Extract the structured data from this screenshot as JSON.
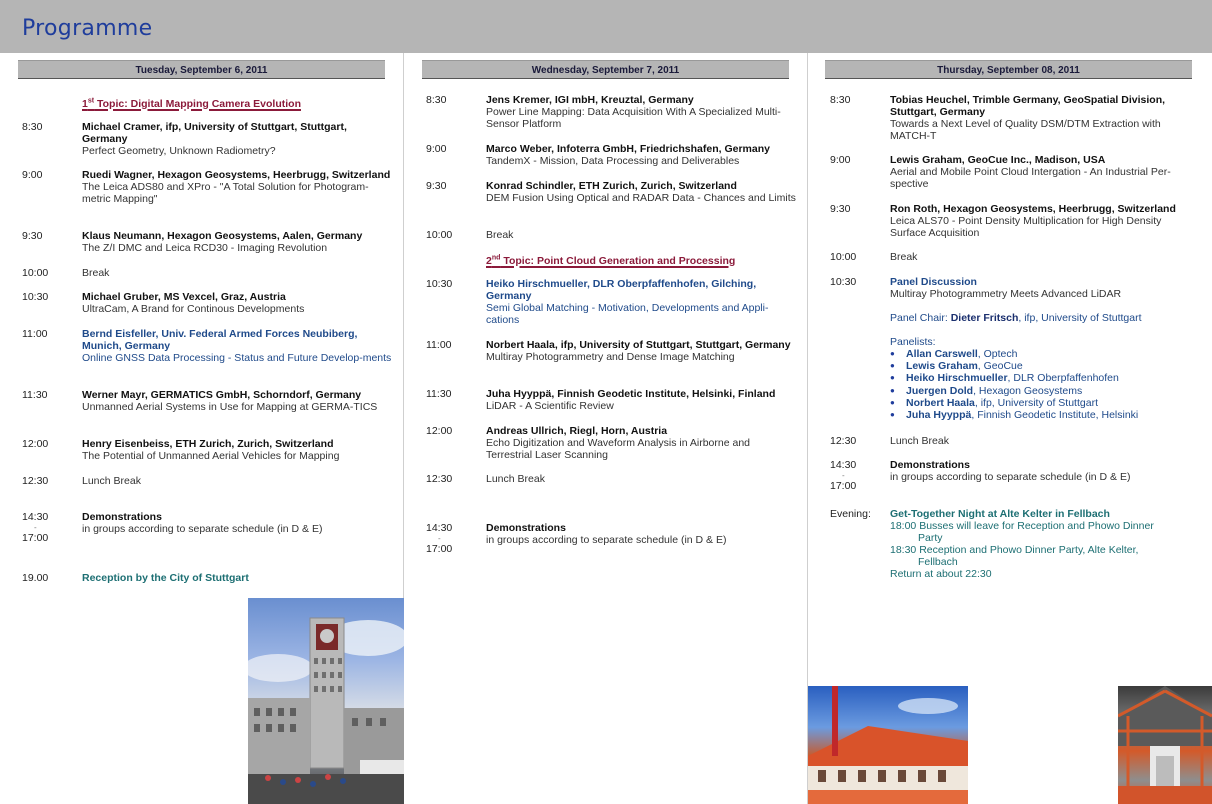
{
  "page": {
    "title": "Programme"
  },
  "day1": {
    "header": "Tuesday, September 6, 2011",
    "topic1_num": "1",
    "topic1_sup": "st",
    "topic1_text": " Topic: Digital Mapping Camera Evolution",
    "items": [
      {
        "time": "8:30",
        "speaker": "Michael Cramer, ifp, University of Stuttgart, Stuttgart, Germany",
        "title": "Perfect Geometry, Unknown Radiometry?"
      },
      {
        "time": "9:00",
        "speaker": "Ruedi Wagner, Hexagon Geosystems, Heerbrugg, Switzerland",
        "title": "The Leica ADS80 and XPro - \"A Total Solution for Photogram-metric Mapping\""
      },
      {
        "time": "9:30",
        "speaker": "Klaus Neumann, Hexagon Geosystems, Aalen, Germany",
        "title": "The Z/I DMC and Leica RCD30 - Imaging Revolution"
      },
      {
        "time": "10:00",
        "title": "Break"
      },
      {
        "time": "10:30",
        "speaker": "Michael Gruber, MS Vexcel, Graz, Austria",
        "title": "UltraCam, A Brand for Continous Developments"
      },
      {
        "time": "11:00",
        "speaker": "Bernd Eisfeller, Univ. Federal Armed Forces Neubiberg, Munich, Germany",
        "title": "Online GNSS Data Processing - Status and Future Develop-ments"
      },
      {
        "time": "11:30",
        "speaker": "Werner Mayr, GERMATICS GmbH, Schorndorf, Germany",
        "title": "Unmanned Aerial Systems in Use for Mapping at GERMA-TICS"
      },
      {
        "time": "12:00",
        "speaker": "Henry Eisenbeiss, ETH Zurich, Zurich, Switzerland",
        "title": "The Potential of Unmanned Aerial Vehicles for Mapping"
      },
      {
        "time": "12:30",
        "title": "Lunch Break"
      },
      {
        "time": "14:30",
        "time_end": "17:00",
        "dash": "-",
        "speaker": "Demonstrations",
        "title": "in groups according to separate schedule (in D & E)"
      },
      {
        "time": "19.00",
        "speaker": "Reception by the City of Stuttgart"
      }
    ]
  },
  "day2": {
    "header": "Wednesday, September 7, 2011",
    "topic2_num": "2",
    "topic2_sup": "nd",
    "topic2_text": " Topic: Point Cloud Generation and Processing",
    "items": [
      {
        "time": "8:30",
        "speaker": "Jens Kremer, IGI mbH, Kreuztal, Germany",
        "title": "Power Line Mapping: Data Acquisition With A Specialized Multi-Sensor Platform"
      },
      {
        "time": "9:00",
        "speaker": "Marco Weber, Infoterra GmbH, Friedrichshafen, Germany",
        "title": "TandemX - Mission, Data Processing and Deliverables"
      },
      {
        "time": "9:30",
        "speaker": "Konrad Schindler, ETH Zurich, Zurich, Switzerland",
        "title": "DEM Fusion Using Optical and RADAR Data - Chances and Limits"
      },
      {
        "time": "10:00",
        "title": "Break"
      },
      {
        "time": "10:30",
        "speaker": "Heiko Hirschmueller, DLR Oberpfaffenhofen, Gilching, Germany",
        "title": "Semi Global Matching - Motivation, Developments and Appli-cations"
      },
      {
        "time": "11:00",
        "speaker": "Norbert Haala, ifp, University of Stuttgart, Stuttgart, Germany",
        "title": "Multiray Photogrammetry and Dense Image Matching"
      },
      {
        "time": "11:30",
        "speaker": "Juha Hyyppä, Finnish Geodetic Institute, Helsinki, Finland",
        "title": "LiDAR - A Scientific Review"
      },
      {
        "time": "12:00",
        "speaker": "Andreas Ullrich, Riegl, Horn, Austria",
        "title": "Echo Digitization and Waveform Analysis in Airborne and Terrestrial Laser Scanning"
      },
      {
        "time": "12:30",
        "title": "Lunch Break"
      },
      {
        "time": "14:30",
        "time_end": "17:00",
        "dash": "-",
        "speaker": "Demonstrations",
        "title": "in groups according to separate schedule (in D & E)"
      }
    ]
  },
  "day3": {
    "header": "Thursday, September 08, 2011",
    "items": [
      {
        "time": "8:30",
        "speaker": "Tobias Heuchel, Trimble Germany, GeoSpatial Division, Stuttgart, Germany",
        "title": "Towards a Next Level of Quality DSM/DTM Extraction with MATCH-T"
      },
      {
        "time": "9:00",
        "speaker": "Lewis Graham, GeoCue Inc., Madison, USA",
        "title": "Aerial and Mobile Point Cloud Intergation - An Industrial Per-spective"
      },
      {
        "time": "9:30",
        "speaker": "Ron Roth, Hexagon Geosystems, Heerbrugg, Switzerland",
        "title": "Leica ALS70 - Point Density Multiplication for High Density Surface Acquisition"
      },
      {
        "time": "10:00",
        "title": "Break"
      },
      {
        "time": "10:30",
        "speaker": "Panel Discussion",
        "title": "Multiray Photogrammetry Meets Advanced LiDAR"
      },
      {
        "time": "12:30",
        "title": "Lunch Break"
      },
      {
        "time": "14:30",
        "time_end": "17:00",
        "dash": "-",
        "speaker": "Demonstrations",
        "title": "in groups according to separate schedule (in D & E)"
      },
      {
        "time": "Evening:",
        "speaker": "Get-Together Night at Alte Kelter in Fellbach"
      }
    ],
    "panel_chair_label": "Panel Chair: ",
    "panel_chair_name": "Dieter Fritsch",
    "panel_chair_affil": ", ifp, University of Stuttgart",
    "panelists_label": "Panelists:",
    "panelists": [
      {
        "name": "Allan Carswell",
        "affil": ", Optech"
      },
      {
        "name": "Lewis Graham",
        "affil": ", GeoCue"
      },
      {
        "name": "Heiko Hirschmueller",
        "affil": ", DLR Oberpfaffenhofen"
      },
      {
        "name": "Juergen Dold",
        "affil": ", Hexagon Geosystems"
      },
      {
        "name": "Norbert Haala",
        "affil": ", ifp, University of Stuttgart"
      },
      {
        "name": "Juha Hyyppä",
        "affil": ", Finnish Geodetic Institute, Helsinki"
      }
    ],
    "evening_lines": [
      "18:00 Busses will leave for Reception and Phowo Dinner",
      "Party",
      "18:30 Reception and Phowo Dinner Party, Alte Kelter,",
      "Fellbach",
      "Return at about 22:30"
    ]
  }
}
